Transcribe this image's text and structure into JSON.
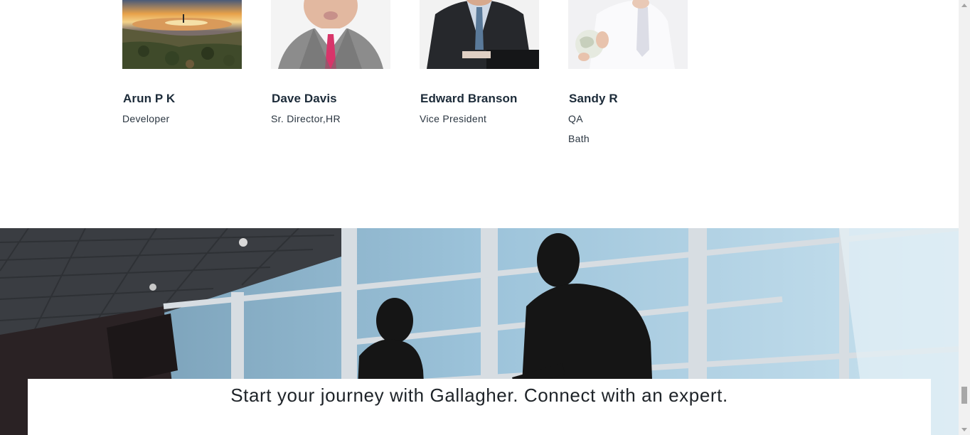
{
  "team": [
    {
      "name": "Arun P K",
      "lines": [
        "Developer"
      ],
      "photo_icon": "landscape-photo"
    },
    {
      "name": "Dave Davis",
      "lines": [
        "Sr. Director,HR"
      ],
      "photo_icon": "portrait-photo"
    },
    {
      "name": "Edward Branson",
      "lines": [
        "Vice President"
      ],
      "photo_icon": "laptop-business-photo"
    },
    {
      "name": "Sandy R",
      "lines": [
        "QA",
        "Bath"
      ],
      "photo_icon": "globe-holding-photo"
    }
  ],
  "cta": {
    "text": "Start your journey with Gallagher. Connect with an expert."
  },
  "colors": {
    "name_text": "#1c2b39",
    "sky": "#8fbcd6",
    "dark_frame": "#1f2124"
  }
}
